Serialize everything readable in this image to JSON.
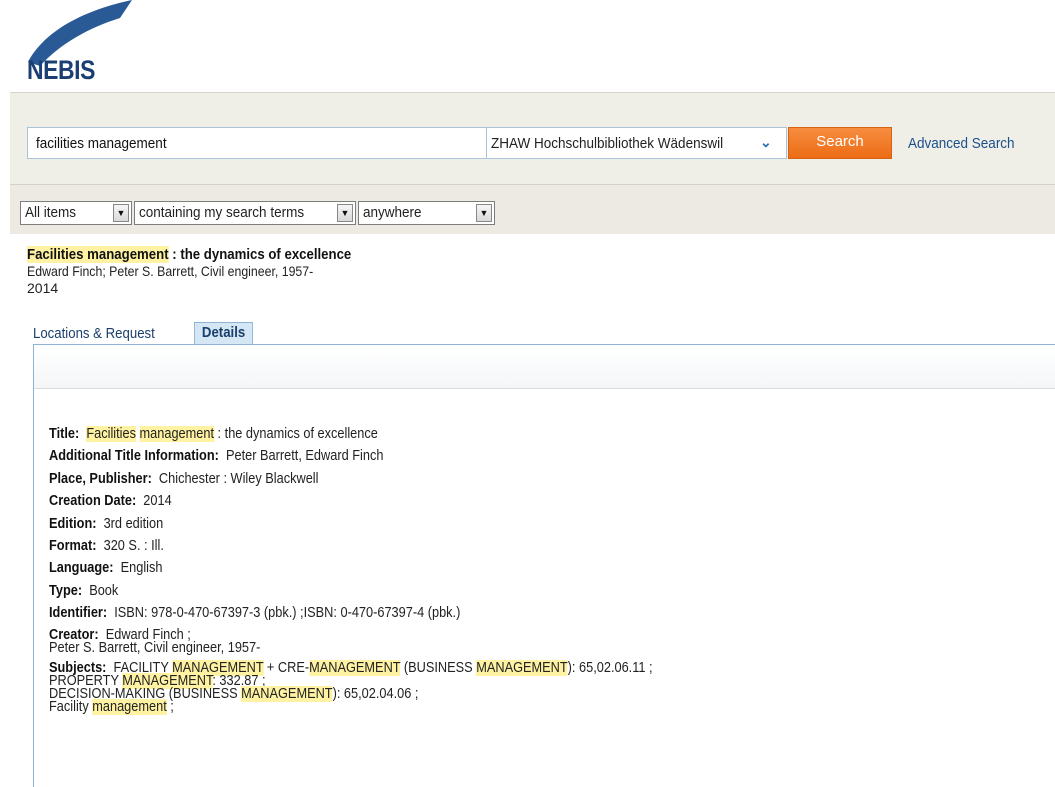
{
  "logo": {
    "text": "NEBIS",
    "colors": {
      "swoosh": "#2a5a96",
      "text": "#1b3f73"
    }
  },
  "search": {
    "query": "facilities management",
    "scope": "ZHAW Hochschulbibliothek Wädenswil",
    "button_label": "Search",
    "advanced_label": "Advanced Search",
    "accent_color": "#ec6c15"
  },
  "filters": {
    "item_type": "All items",
    "match_mode": "containing my search terms",
    "field": "anywhere"
  },
  "record": {
    "title_highlight": "Facilities management",
    "title_rest": " : the dynamics of excellence",
    "authors": "Edward Finch; Peter S. Barrett, Civil engineer, 1957-",
    "date": "2014"
  },
  "tabs": {
    "locations": "Locations & Request",
    "details": "Details"
  },
  "details": {
    "title_label": "Title:",
    "title_hl1": "Facilities",
    "title_hl2": "management",
    "title_rest": " : the dynamics of excellence",
    "additional_label": "Additional Title Information:",
    "additional_value": "Peter Barrett, Edward Finch",
    "publisher_label": "Place, Publisher:",
    "publisher_value": "Chichester : Wiley Blackwell",
    "creation_label": "Creation Date:",
    "creation_value": "2014",
    "edition_label": "Edition:",
    "edition_value": "3rd edition",
    "format_label": "Format:",
    "format_value": "320 S. : Ill.",
    "language_label": "Language:",
    "language_value": "English",
    "type_label": "Type:",
    "type_value": "Book",
    "identifier_label": "Identifier:",
    "identifier_value": "ISBN: 978-0-470-67397-3 (pbk.) ;ISBN: 0-470-67397-4 (pbk.)",
    "creator_label": "Creator:",
    "creator_value_1": "Edward Finch ;",
    "creator_value_2": "Peter S. Barrett, Civil engineer, 1957-",
    "subjects_label": "Subjects:",
    "subj1_a": "FACILITY ",
    "subj1_b": "MANAGEMENT",
    "subj1_c": " + CRE-",
    "subj1_d": "MANAGEMENT",
    "subj1_e": " (BUSINESS ",
    "subj1_f": "MANAGEMENT",
    "subj1_g": "): 65,02.06.11 ;",
    "subj2_a": "PROPERTY ",
    "subj2_b": "MANAGEMENT",
    "subj2_c": ": 332.87 ;",
    "subj3_a": "DECISION-MAKING (BUSINESS ",
    "subj3_b": "MANAGEMENT",
    "subj3_c": "): 65,02.04.06 ;",
    "subj4_a": "Facility ",
    "subj4_b": "management",
    "subj4_c": " ;"
  }
}
